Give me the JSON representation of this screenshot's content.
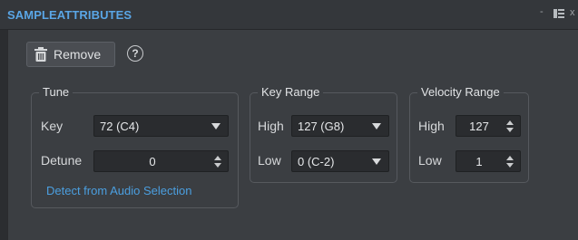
{
  "window": {
    "title": "SAMPLEATTRIBUTES",
    "minimize_glyph": "-",
    "close_glyph": "x"
  },
  "toolbar": {
    "remove_label": "Remove",
    "help_glyph": "?"
  },
  "tune": {
    "title": "Tune",
    "key_label": "Key",
    "key_value": "72 (C4)",
    "detune_label": "Detune",
    "detune_value": "0",
    "detect_link": "Detect from Audio Selection"
  },
  "key_range": {
    "title": "Key Range",
    "high_label": "High",
    "high_value": "127 (G8)",
    "low_label": "Low",
    "low_value": "0 (C-2)"
  },
  "velocity_range": {
    "title": "Velocity Range",
    "high_label": "High",
    "high_value": "127",
    "low_label": "Low",
    "low_value": "1"
  },
  "colors": {
    "accent": "#5aa6e6",
    "link": "#4b9fe0",
    "panel_bg": "#3b3e42",
    "field_bg": "#2a2c2f"
  },
  "icons": [
    "trash-icon",
    "help-icon",
    "dropdown-arrow-icon",
    "spin-arrows-icon",
    "panel-layout-icon"
  ]
}
